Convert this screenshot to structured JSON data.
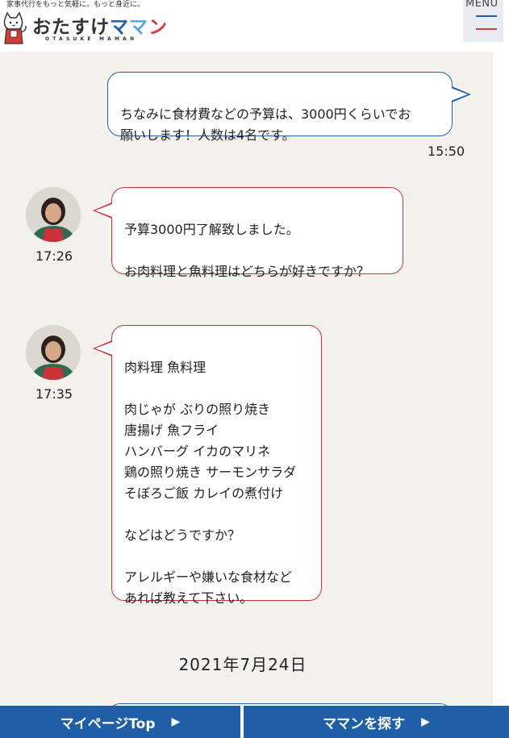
{
  "header": {
    "tagline": "家事代行をもっと気軽に。もっと身近に。",
    "logo_prefix": "おたすけ",
    "logo_m1": "マ",
    "logo_m2": "マ",
    "logo_n": "ン",
    "logo_sub": "OTASUKE MAMAN",
    "menu_label": "MENU"
  },
  "messages": [
    {
      "sender": "user",
      "text": "ちなみに食材費などの予算は、3000円くらいでお\n願いします！人数は4名です。",
      "time": "15:50"
    },
    {
      "sender": "staff",
      "text": "予算3000円了解致しました。\n\nお肉料理と魚料理はどちらが好きですか？",
      "time": "17:26"
    },
    {
      "sender": "staff",
      "text": "肉料理 魚料理\n\n肉じゃが ぶりの照り焼き\n唐揚げ 魚フライ\nハンバーグ イカのマリネ\n鶏の照り焼き サーモンサラダ\nそぼろご飯 カレイの煮付け\n\nなどはどうですか？\n\nアレルギーや嫌いな食材など\nあれば教えて下さい。",
      "time": "17:35"
    }
  ],
  "date_separator": "2021年7月24日",
  "bottom_nav": {
    "mypage_label": "マイページTop",
    "search_label": "ママンを探す",
    "arrow": "▶"
  },
  "colors": {
    "brand_blue": "#1f5fa8",
    "brand_red": "#c8333a",
    "chat_bg": "#f3f1ec"
  }
}
